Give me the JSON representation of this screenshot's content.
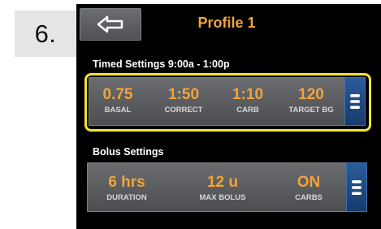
{
  "step_number": "6.",
  "header": {
    "title": "Profile 1",
    "back_icon": "arrow-left-icon"
  },
  "timed_settings": {
    "label": "Timed Settings 9:00a - 1:00p",
    "highlight_color": "#f2e33a",
    "items": [
      {
        "value": "0.75",
        "label": "BASAL"
      },
      {
        "value": "1:50",
        "label": "CORRECT"
      },
      {
        "value": "1:10",
        "label": "CARB"
      },
      {
        "value": "120",
        "label": "TARGET BG"
      }
    ],
    "menu_icon": "menu-icon"
  },
  "bolus_settings": {
    "label": "Bolus Settings",
    "items": [
      {
        "value": "6 hrs",
        "label": "DURATION"
      },
      {
        "value": "12 u",
        "label": "MAX BOLUS"
      },
      {
        "value": "ON",
        "label": "CARBS"
      }
    ],
    "menu_icon": "menu-icon"
  },
  "colors": {
    "accent": "#f2a43a",
    "menu_button": "#1f4a80",
    "screen_background": "#000000"
  }
}
